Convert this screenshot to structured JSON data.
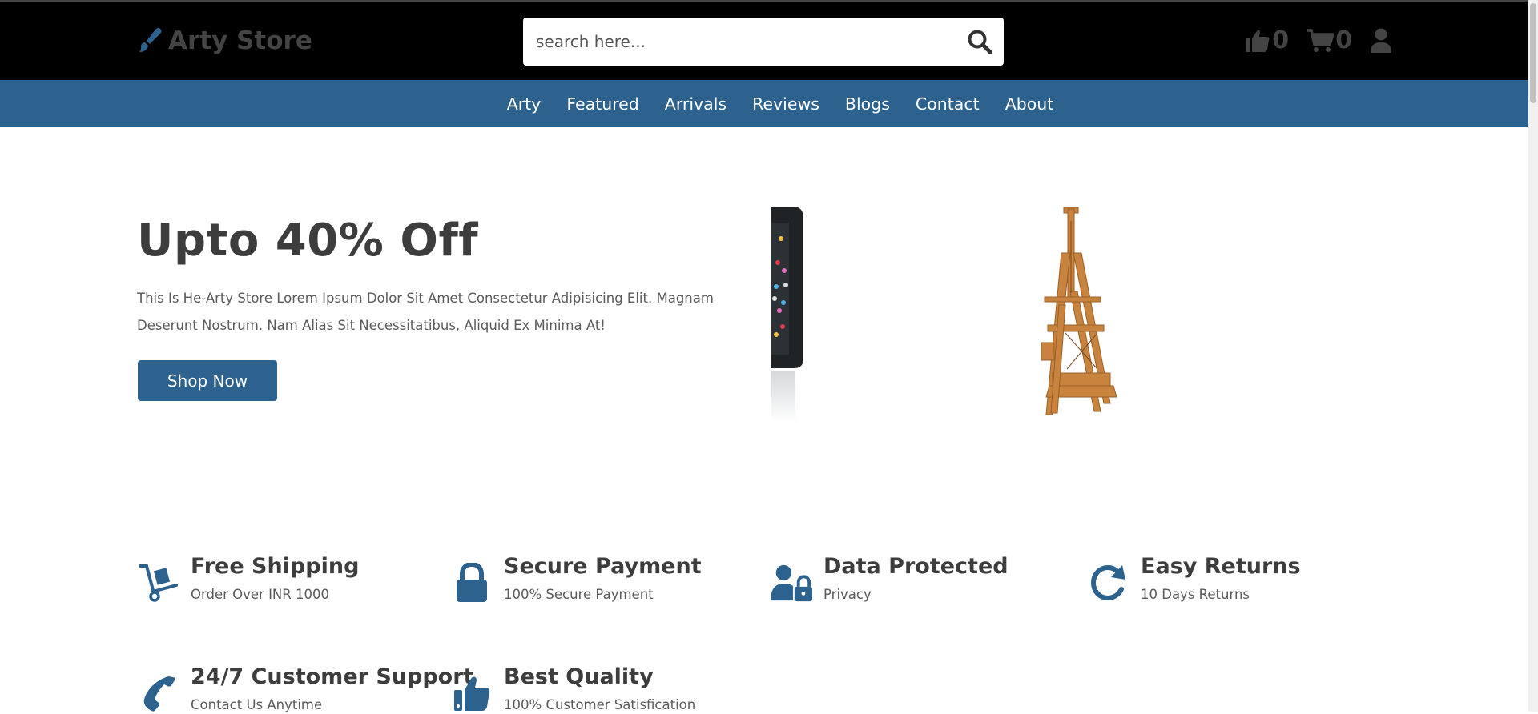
{
  "header": {
    "brand": "Arty Store",
    "search_placeholder": "search here...",
    "likes_count": "0",
    "cart_count": "0"
  },
  "nav": {
    "items": [
      {
        "label": "Arty"
      },
      {
        "label": "Featured"
      },
      {
        "label": "Arrivals"
      },
      {
        "label": "Reviews"
      },
      {
        "label": "Blogs"
      },
      {
        "label": "Contact"
      },
      {
        "label": "About"
      }
    ]
  },
  "hero": {
    "title": "Upto 40% Off",
    "description": "This Is He-Arty Store Lorem Ipsum Dolor Sit Amet Consectetur Adipisicing Elit. Magnam Deserunt Nostrum. Nam Alias Sit Necessitatibus, Aliquid Ex Minima At!",
    "button": "Shop Now"
  },
  "features": [
    {
      "title": "Free Shipping",
      "subtitle": "Order Over INR 1000",
      "icon": "dolly-icon"
    },
    {
      "title": "Secure Payment",
      "subtitle": "100% Secure Payment",
      "icon": "lock-icon"
    },
    {
      "title": "Data Protected",
      "subtitle": "Privacy",
      "icon": "user-lock-icon"
    },
    {
      "title": "Easy Returns",
      "subtitle": "10 Days Returns",
      "icon": "redo-icon"
    },
    {
      "title": "24/7 Customer Support",
      "subtitle": "Contact Us Anytime",
      "icon": "phone-icon"
    },
    {
      "title": "Best Quality",
      "subtitle": "100% Customer Satisfication",
      "icon": "thumbs-up-icon"
    }
  ],
  "colors": {
    "header_bg": "#000000",
    "nav_bg": "#2c628d",
    "accent": "#2c628d",
    "text_dark": "#3d3d3d"
  }
}
